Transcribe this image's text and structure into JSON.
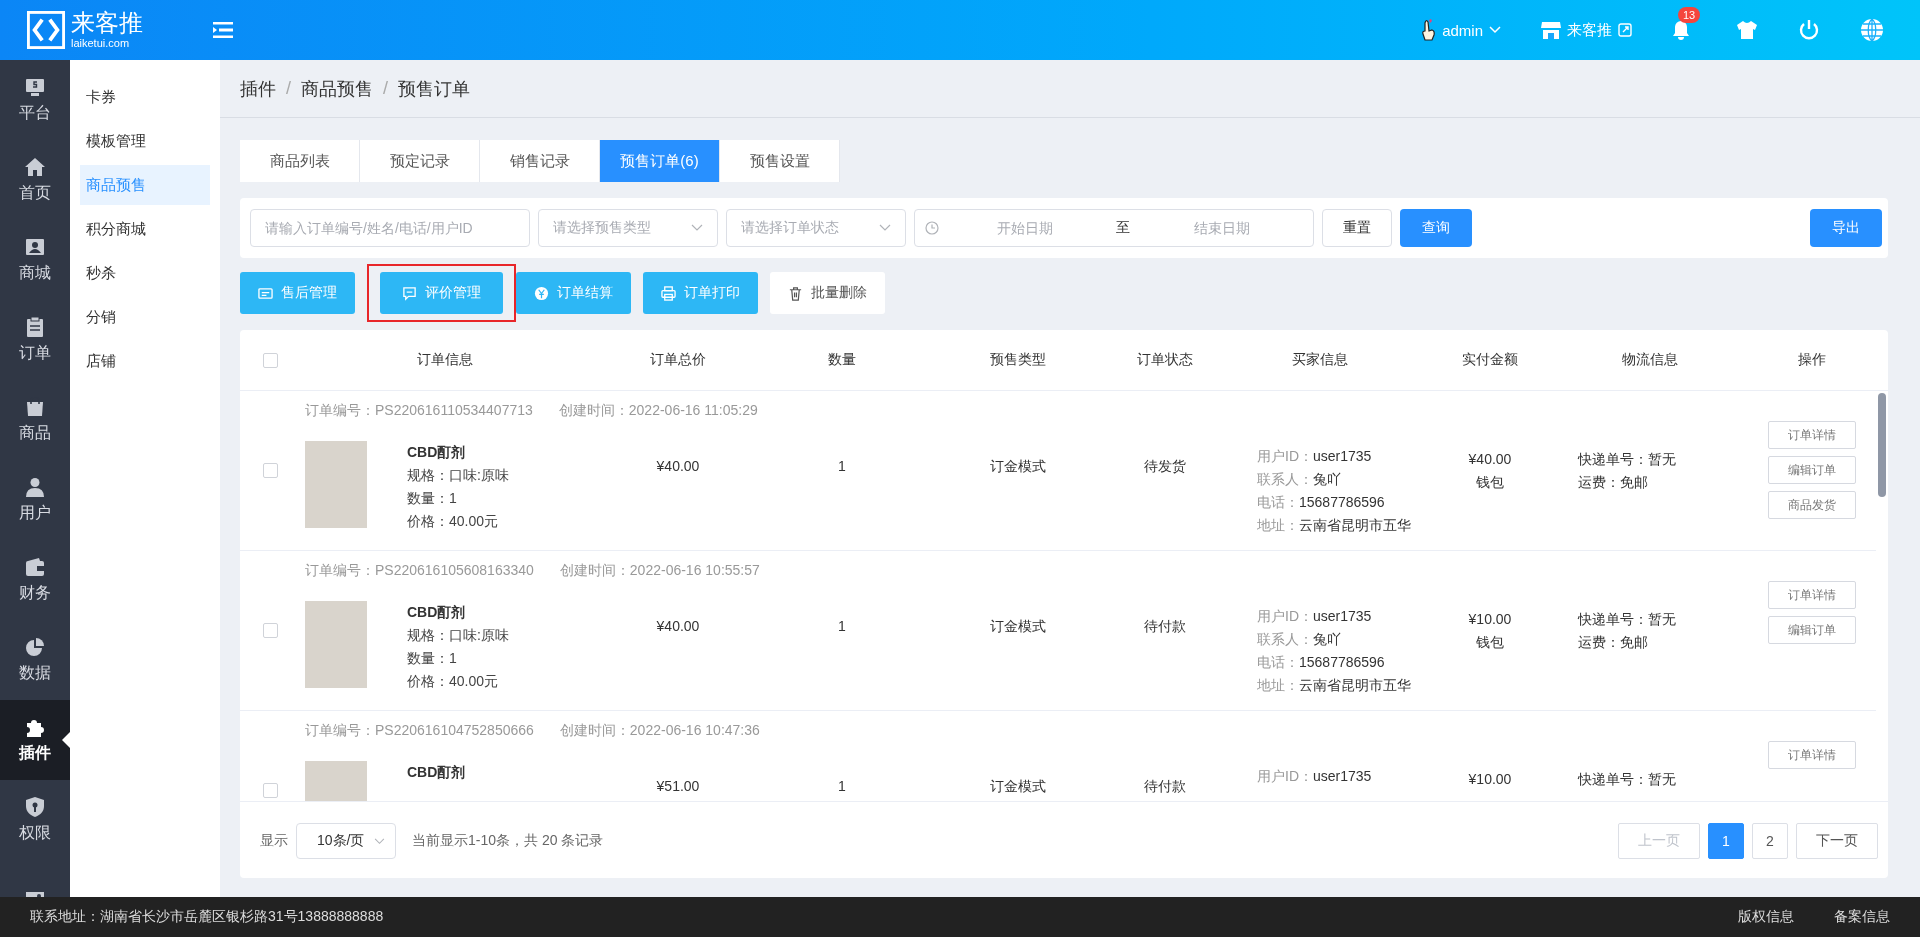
{
  "header": {
    "logo_name": "来客推",
    "logo_domain": "laiketui.com",
    "user": "admin",
    "shop": "来客推",
    "notification_count": "13"
  },
  "rail": [
    {
      "label": "平台",
      "selected": false
    },
    {
      "label": "首页",
      "selected": false
    },
    {
      "label": "商城",
      "selected": false
    },
    {
      "label": "订单",
      "selected": false
    },
    {
      "label": "商品",
      "selected": false
    },
    {
      "label": "用户",
      "selected": false
    },
    {
      "label": "财务",
      "selected": false
    },
    {
      "label": "数据",
      "selected": false
    },
    {
      "label": "插件",
      "selected": true
    },
    {
      "label": "权限",
      "selected": false
    }
  ],
  "submenu": [
    {
      "label": "卡券",
      "selected": false
    },
    {
      "label": "模板管理",
      "selected": false
    },
    {
      "label": "商品预售",
      "selected": true
    },
    {
      "label": "积分商城",
      "selected": false
    },
    {
      "label": "秒杀",
      "selected": false
    },
    {
      "label": "分销",
      "selected": false
    },
    {
      "label": "店铺",
      "selected": false
    }
  ],
  "breadcrumb": {
    "items": [
      "插件",
      "商品预售",
      "预售订单"
    ],
    "separator": "/"
  },
  "tabs": [
    {
      "label": "商品列表",
      "selected": false
    },
    {
      "label": "预定记录",
      "selected": false
    },
    {
      "label": "销售记录",
      "selected": false
    },
    {
      "label": "预售订单(6)",
      "selected": true
    },
    {
      "label": "预售设置",
      "selected": false
    }
  ],
  "filters": {
    "search_placeholder": "请输入订单编号/姓名/电话/用户ID",
    "type_placeholder": "请选择预售类型",
    "status_placeholder": "请选择订单状态",
    "start_placeholder": "开始日期",
    "range_separator": "至",
    "end_placeholder": "结束日期",
    "reset": "重置",
    "query": "查询",
    "export": "导出"
  },
  "actions": [
    {
      "label": "售后管理",
      "kind": "primary",
      "highlighted": false
    },
    {
      "label": "评价管理",
      "kind": "primary",
      "highlighted": true
    },
    {
      "label": "订单结算",
      "kind": "primary",
      "highlighted": false
    },
    {
      "label": "订单打印",
      "kind": "primary",
      "highlighted": false
    },
    {
      "label": "批量删除",
      "kind": "plain",
      "highlighted": false
    }
  ],
  "table": {
    "header_checked": false,
    "columns": [
      "订单信息",
      "订单总价",
      "数量",
      "预售类型",
      "订单状态",
      "买家信息",
      "实付金额",
      "物流信息",
      "操作"
    ],
    "rows": [
      {
        "checked": false,
        "order_no": "订单编号：PS220616110534407713",
        "created": "创建时间：2022-06-16 11:05:29",
        "product_name": "CBD酊剂",
        "product_lines": [
          "规格：口味:原味",
          "数量：1",
          "价格：40.00元"
        ],
        "total": "¥40.00",
        "quantity": "1",
        "presale_type": "订金模式",
        "status": "待发货",
        "buyer": [
          {
            "label": "用户ID：",
            "value": "user1735"
          },
          {
            "label": "联系人：",
            "value": "兔吖"
          },
          {
            "label": "电话：",
            "value": "15687786596"
          },
          {
            "label": "地址：",
            "value": "云南省昆明市五华"
          }
        ],
        "paid": [
          "¥40.00",
          "钱包"
        ],
        "logistics": [
          "快递单号：暂无",
          "运费：免邮"
        ],
        "operations": [
          "订单详情",
          "编辑订单",
          "商品发货"
        ]
      },
      {
        "checked": false,
        "order_no": "订单编号：PS220616105608163340",
        "created": "创建时间：2022-06-16 10:55:57",
        "product_name": "CBD酊剂",
        "product_lines": [
          "规格：口味:原味",
          "数量：1",
          "价格：40.00元"
        ],
        "total": "¥40.00",
        "quantity": "1",
        "presale_type": "订金模式",
        "status": "待付款",
        "buyer": [
          {
            "label": "用户ID：",
            "value": "user1735"
          },
          {
            "label": "联系人：",
            "value": "兔吖"
          },
          {
            "label": "电话：",
            "value": "15687786596"
          },
          {
            "label": "地址：",
            "value": "云南省昆明市五华"
          }
        ],
        "paid": [
          "¥10.00",
          "钱包"
        ],
        "logistics": [
          "快递单号：暂无",
          "运费：免邮"
        ],
        "operations": [
          "订单详情",
          "编辑订单"
        ]
      },
      {
        "checked": false,
        "order_no": "订单编号：PS220616104752850666",
        "created": "创建时间：2022-06-16 10:47:36",
        "product_name": "CBD酊剂",
        "product_lines": [],
        "total": "¥51.00",
        "quantity": "1",
        "presale_type": "订金模式",
        "status": "待付款",
        "buyer": [
          {
            "label": "用户ID：",
            "value": "user1735"
          }
        ],
        "paid": [
          "¥10.00"
        ],
        "logistics": [
          "快递单号：暂无"
        ],
        "operations": [
          "订单详情"
        ]
      }
    ]
  },
  "pagination": {
    "show_label": "显示",
    "page_size": "10条/页",
    "summary": "当前显示1-10条，共 20 条记录",
    "prev": "上一页",
    "prev_disabled": true,
    "pages": [
      {
        "label": "1",
        "selected": true
      },
      {
        "label": "2",
        "selected": false
      }
    ],
    "next": "下一页"
  },
  "footer": {
    "address": "联系地址：湖南省长沙市岳麓区银杉路31号13888888888",
    "links": [
      "版权信息",
      "备案信息"
    ]
  }
}
